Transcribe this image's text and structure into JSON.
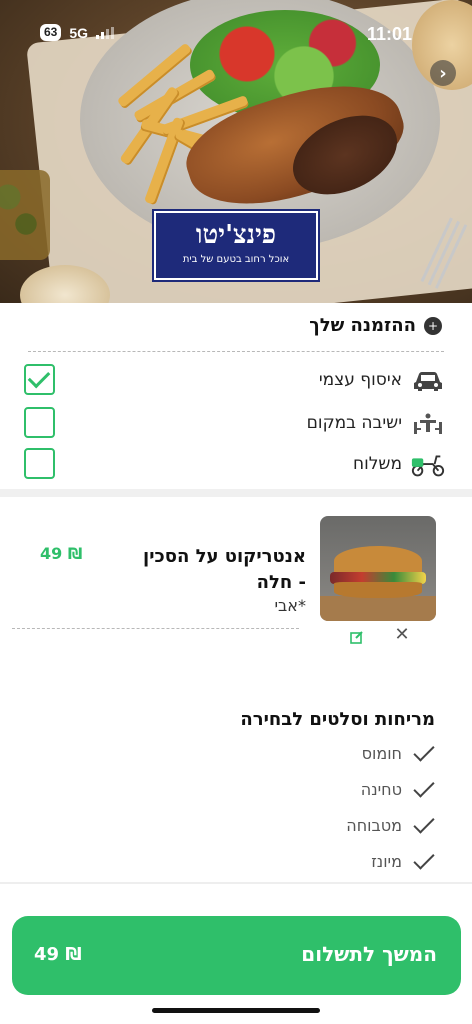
{
  "status_bar": {
    "time": "11:01",
    "network": "5G",
    "battery": "63"
  },
  "restaurant": {
    "logo_title": "פינצ'יטו",
    "logo_subtitle": "אוכל רחוב בטעם של בית"
  },
  "order": {
    "section_title": "ההזמנה שלך",
    "options": [
      {
        "label": "איסוף עצמי",
        "icon": "car-icon",
        "checked": true
      },
      {
        "label": "ישיבה במקום",
        "icon": "table-icon",
        "checked": false
      },
      {
        "label": "משלוח",
        "icon": "scooter-icon",
        "checked": false
      }
    ]
  },
  "cart_item": {
    "name": "אנטריקוט על הסכין - חלה",
    "note": "*אבי",
    "price": "49 ₪"
  },
  "extras": {
    "title": "מריחות וסלטים לבחירה",
    "items": [
      "חומוס",
      "טחינה",
      "מטבוחה",
      "מיונז"
    ]
  },
  "checkout": {
    "label": "המשך לתשלום",
    "price": "49 ₪"
  },
  "colors": {
    "accent": "#2fbf6a",
    "logo_bg": "#1e2a7a"
  }
}
